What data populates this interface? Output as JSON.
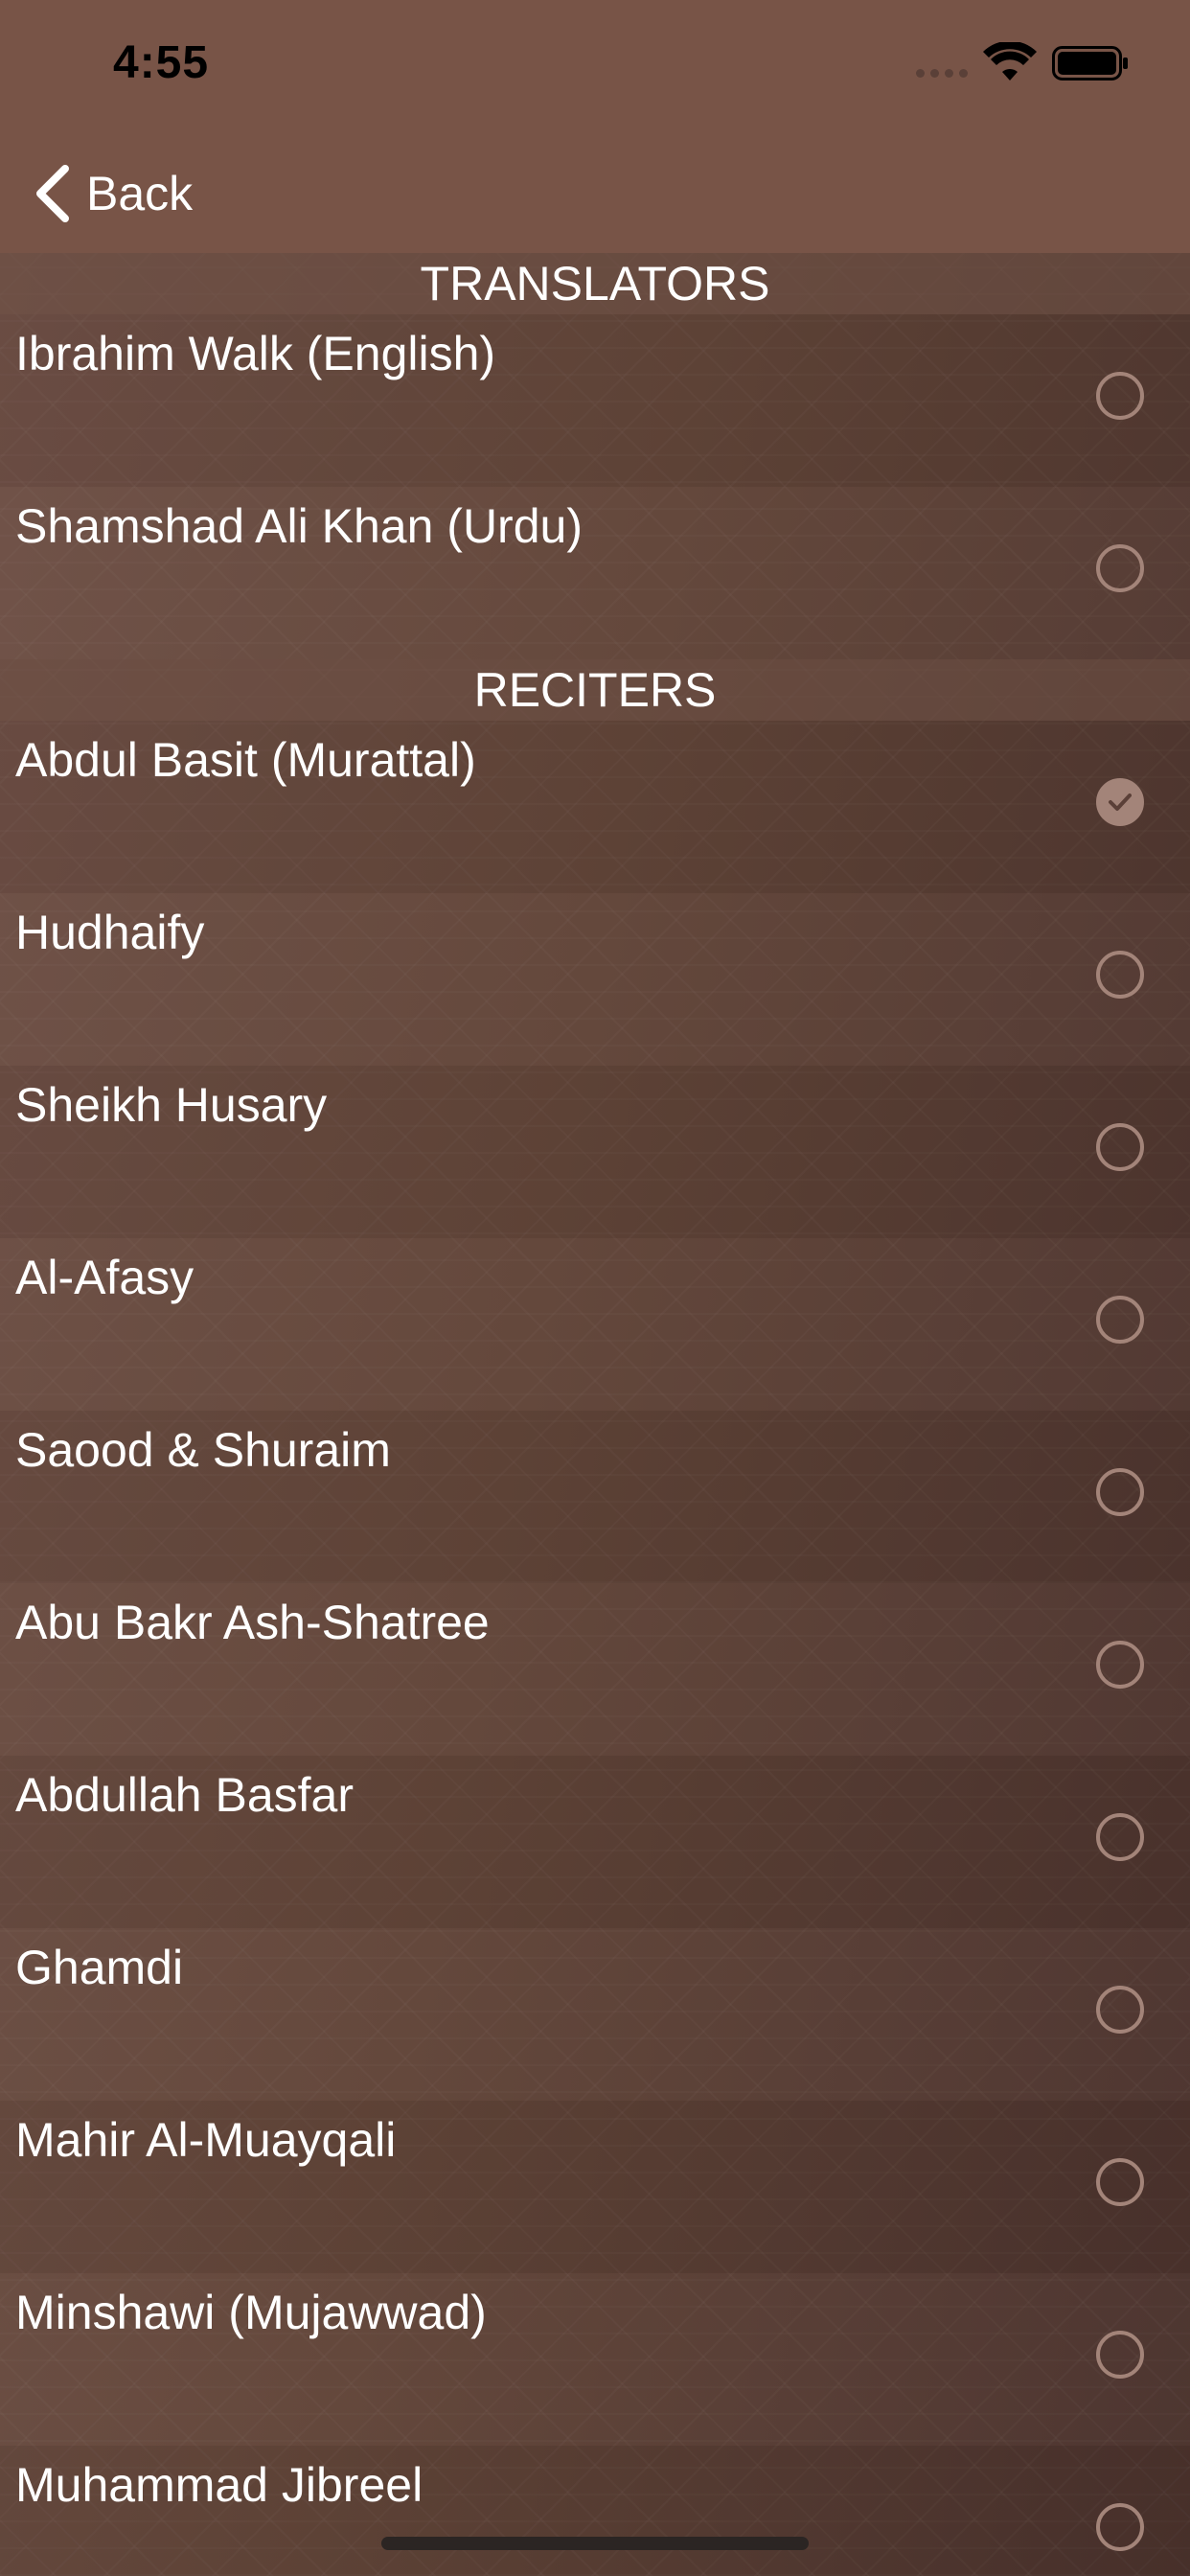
{
  "status_bar": {
    "time": "4:55"
  },
  "nav": {
    "back_label": "Back"
  },
  "sections": [
    {
      "header": "TRANSLATORS",
      "items": [
        {
          "label": "Ibrahim Walk (English)",
          "selected": false
        },
        {
          "label": "Shamshad Ali Khan (Urdu)",
          "selected": false
        }
      ]
    },
    {
      "header": "RECITERS",
      "items": [
        {
          "label": "Abdul Basit (Murattal)",
          "selected": true
        },
        {
          "label": "Hudhaify",
          "selected": false
        },
        {
          "label": "Sheikh Husary",
          "selected": false
        },
        {
          "label": "Al-Afasy",
          "selected": false
        },
        {
          "label": "Saood & Shuraim",
          "selected": false
        },
        {
          "label": "Abu Bakr Ash-Shatree",
          "selected": false
        },
        {
          "label": "Abdullah Basfar",
          "selected": false
        },
        {
          "label": "Ghamdi",
          "selected": false
        },
        {
          "label": "Mahir Al-Muayqali",
          "selected": false
        },
        {
          "label": "Minshawi (Mujawwad)",
          "selected": false
        },
        {
          "label": "Muhammad Jibreel",
          "selected": false
        }
      ]
    }
  ],
  "icons": {
    "back": "chevron-left-icon",
    "wifi": "wifi-icon",
    "battery": "battery-icon",
    "selected": "checkmark-icon"
  },
  "colors": {
    "nav_background": "#785447",
    "radio": "#a38479",
    "text": "#ffffff"
  }
}
